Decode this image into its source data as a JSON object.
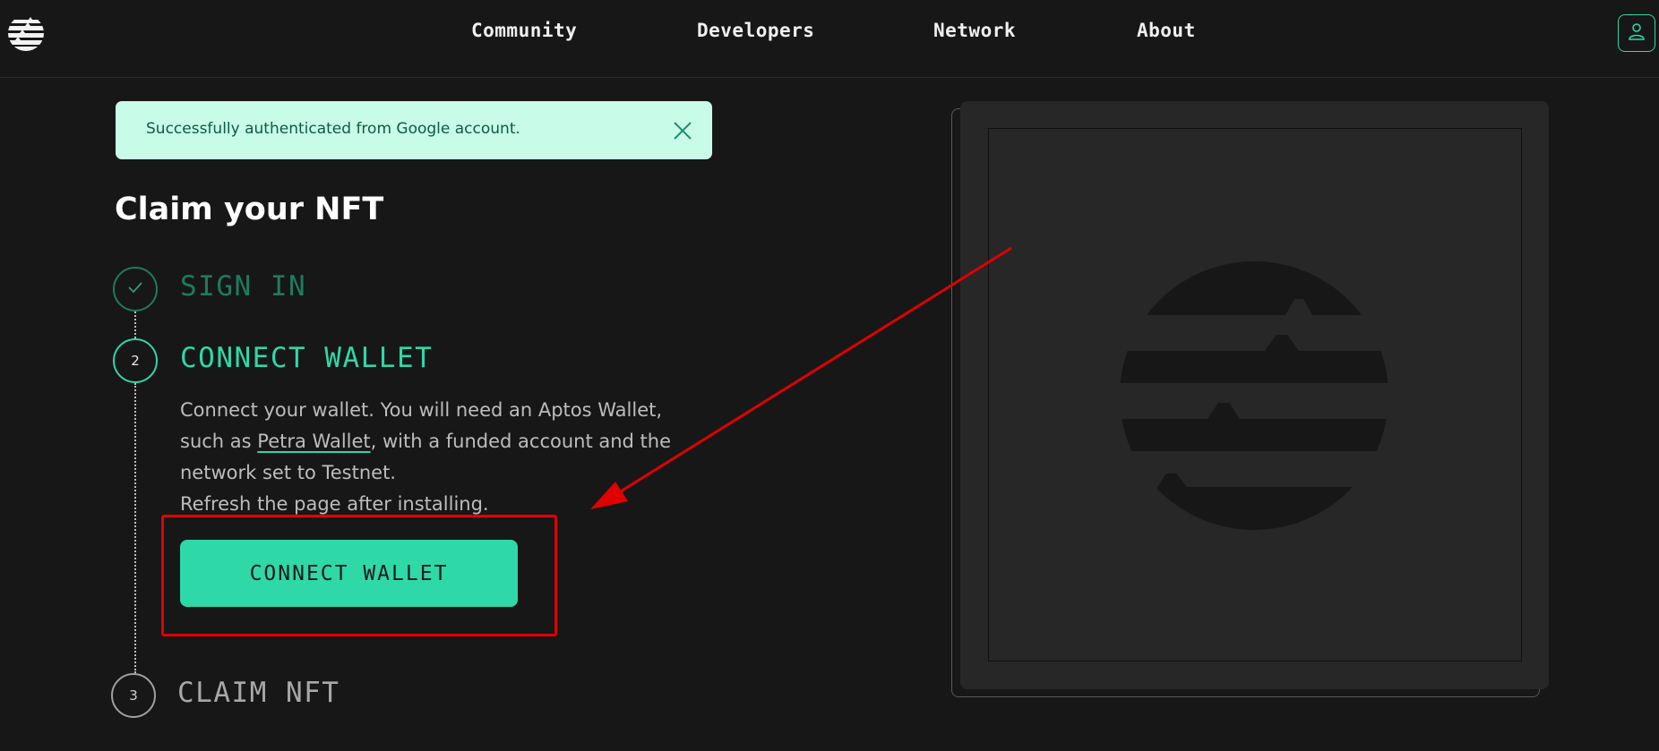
{
  "nav": {
    "links": [
      "Community",
      "Developers",
      "Network",
      "About"
    ],
    "logo_icon": "aptos-logo-icon",
    "account_icon": "user-icon"
  },
  "toast": {
    "message": "Successfully authenticated from Google account.",
    "close_icon": "close-icon"
  },
  "page_title": "Claim your NFT",
  "steps": [
    {
      "marker": "✓",
      "label": "SIGN IN",
      "status": "completed"
    },
    {
      "marker": "2",
      "label": "CONNECT WALLET",
      "status": "active"
    },
    {
      "marker": "3",
      "label": "CLAIM NFT",
      "status": "pending"
    }
  ],
  "connect_step": {
    "desc_part1": "Connect your wallet. You will need an Aptos Wallet, such as ",
    "link_text": "Petra Wallet",
    "desc_part2": ", with a funded account and the network set to Testnet.",
    "desc_line2": "Refresh the page after installing.",
    "button_label": "CONNECT WALLET"
  },
  "colors": {
    "accent": "#2ed8a7",
    "background": "#171717",
    "toast_bg": "#c8fce9",
    "annotation": "#e00000"
  }
}
